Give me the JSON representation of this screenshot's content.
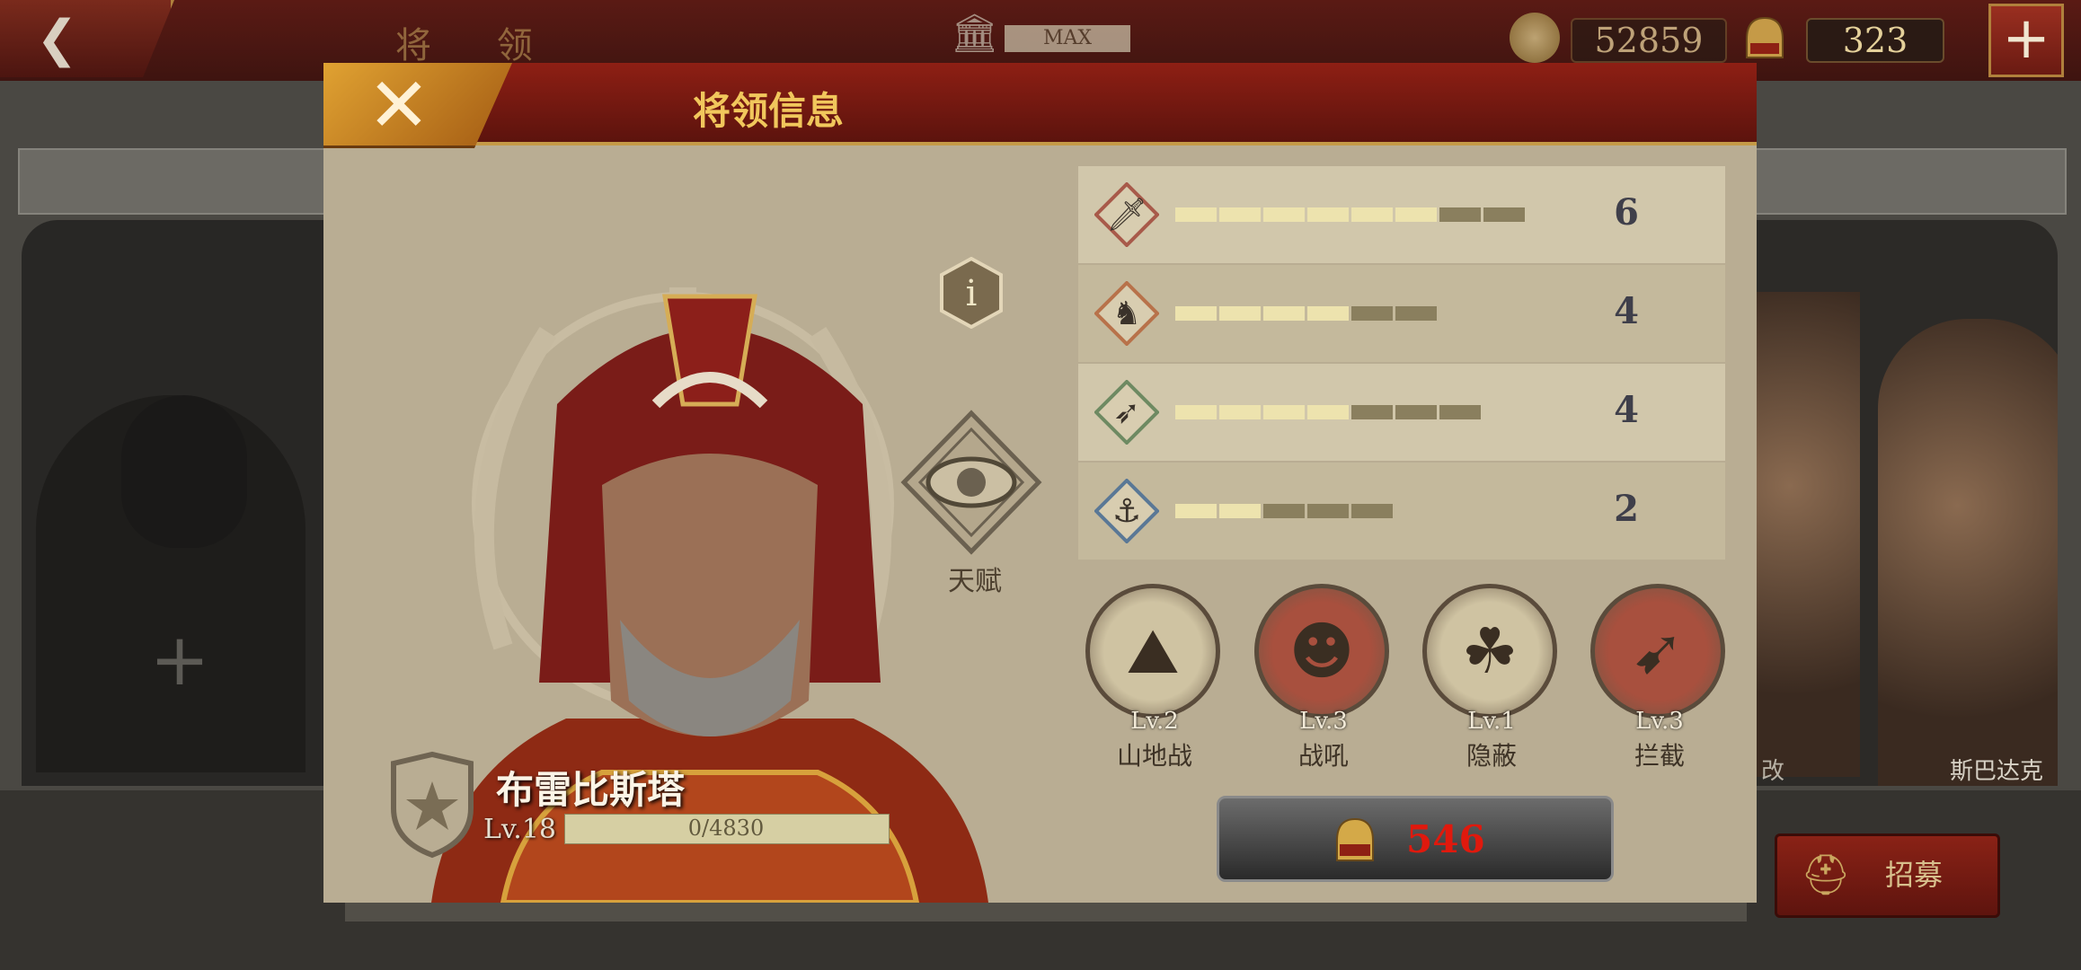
{
  "top_bar": {
    "title": "将 领",
    "max_label": "MAX",
    "coins": "52859",
    "gems": "323",
    "add_label": "+"
  },
  "background": {
    "recruit_label": "招募",
    "right_label_fragment": "斯巴达克",
    "right_label_fragment2": "改"
  },
  "modal": {
    "title": "将领信息",
    "talent_label": "天赋",
    "stats": [
      {
        "icon": "sword-icon",
        "value": "6",
        "filled": 6,
        "total": 8
      },
      {
        "icon": "horse-icon",
        "value": "4",
        "filled": 4,
        "total": 6
      },
      {
        "icon": "bow-icon",
        "value": "4",
        "filled": 4,
        "total": 7
      },
      {
        "icon": "anchor-icon",
        "value": "2",
        "filled": 2,
        "total": 5
      }
    ],
    "skills": [
      {
        "icon": "mountain-icon",
        "level": "Lv.2",
        "name": "山地战"
      },
      {
        "icon": "warcry-icon",
        "level": "Lv.3",
        "name": "战吼"
      },
      {
        "icon": "stealth-icon",
        "level": "Lv.1",
        "name": "隐蔽"
      },
      {
        "icon": "intercept-icon",
        "level": "Lv.3",
        "name": "拦截"
      }
    ],
    "cost": "546",
    "hero": {
      "name": "布雷比斯塔",
      "level": "Lv.18",
      "xp_text": "0/4830",
      "xp_fraction": 0
    }
  },
  "colors": {
    "bar_filled": "#ede3ae",
    "bar_empty": "#8a7f5e",
    "cost_red": "#e0190d",
    "title_gold": "#f1c75c"
  }
}
